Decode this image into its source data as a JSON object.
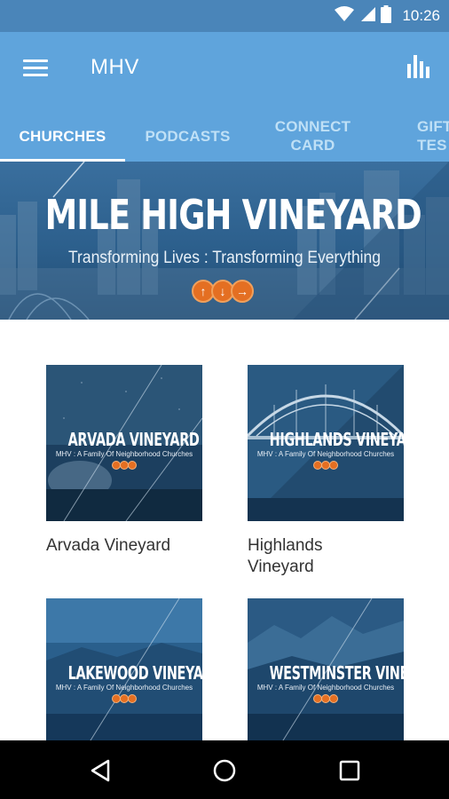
{
  "status_bar": {
    "time": "10:26",
    "icons": [
      "wifi-icon",
      "signal-icon",
      "battery-icon"
    ]
  },
  "app_bar": {
    "title": "MHV",
    "menu_icon": "menu-icon",
    "action_icon": "bar-chart-icon"
  },
  "tabs": [
    {
      "label": "CHURCHES",
      "active": true
    },
    {
      "label": "PODCASTS",
      "active": false
    },
    {
      "label": "CONNECT\nCARD",
      "active": false
    },
    {
      "label": "GIFT\nTES",
      "active": false
    }
  ],
  "banner": {
    "title": "MILE HIGH VINEYARD",
    "subtitle": "Transforming Lives : Transforming Everything"
  },
  "churches": [
    {
      "label": "Arvada Vineyard",
      "thumb_title": "ARVADA VINEYARD",
      "thumb_sub": "MHV : A Family Of Neighborhood Churches"
    },
    {
      "label": "Highlands Vineyard",
      "thumb_title": "HIGHLANDS VINEYARD",
      "thumb_sub": "MHV : A Family Of Neighborhood Churches"
    },
    {
      "label": "",
      "thumb_title": "LAKEWOOD VINEYARD",
      "thumb_sub": "MHV : A Family Of Neighborhood Churches"
    },
    {
      "label": "",
      "thumb_title": "WESTMINSTER VINEYARD",
      "thumb_sub": "MHV : A Family Of Neighborhood Churches"
    }
  ],
  "nav_bar": {
    "icons": [
      "back-icon",
      "home-icon",
      "recents-icon"
    ]
  },
  "colors": {
    "status_bar": "#4a85b9",
    "app_bar": "#5fa4dc",
    "accent_orange": "#e46f22"
  }
}
